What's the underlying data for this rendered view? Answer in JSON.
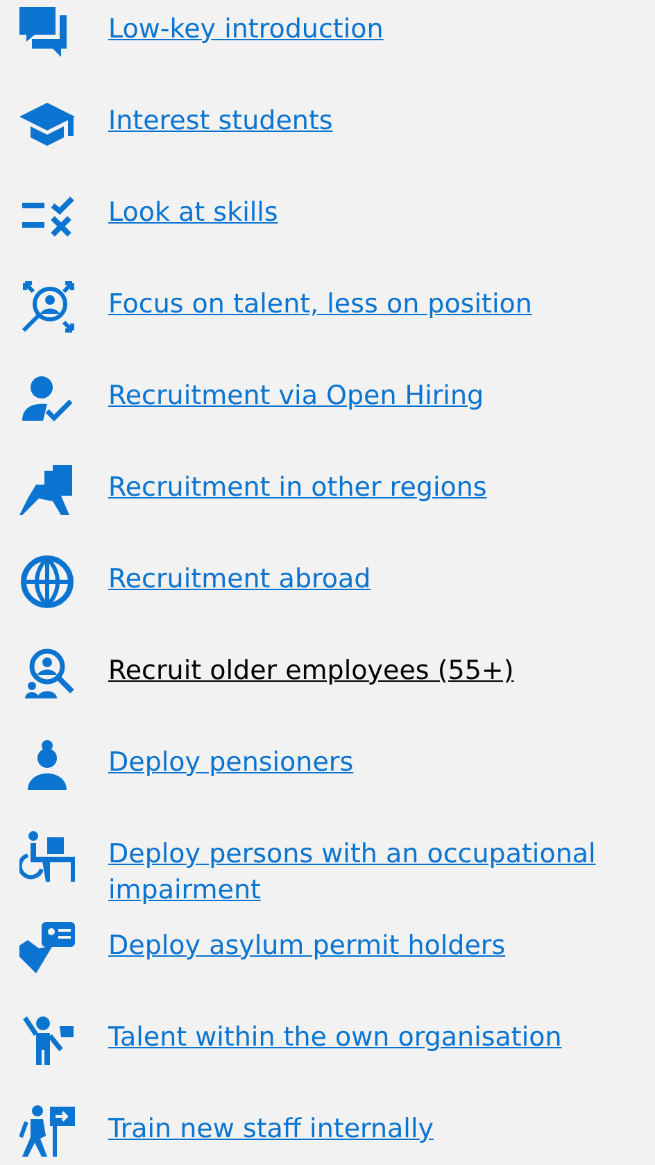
{
  "items": [
    {
      "label": "Low-key introduction",
      "selected": false
    },
    {
      "label": "Interest students",
      "selected": false
    },
    {
      "label": "Look at skills",
      "selected": false
    },
    {
      "label": "Focus on talent, less on position",
      "selected": false
    },
    {
      "label": "Recruitment via Open Hiring",
      "selected": false
    },
    {
      "label": "Recruitment in other regions",
      "selected": false
    },
    {
      "label": "Recruitment abroad",
      "selected": false
    },
    {
      "label": "Recruit older employees (55+)",
      "selected": true
    },
    {
      "label": "Deploy pensioners",
      "selected": false
    },
    {
      "label": "Deploy persons with an occupational impairment",
      "selected": false
    },
    {
      "label": "Deploy asylum permit holders",
      "selected": false
    },
    {
      "label": "Talent within the own organisation",
      "selected": false
    },
    {
      "label": "Train new staff internally",
      "selected": false
    }
  ]
}
